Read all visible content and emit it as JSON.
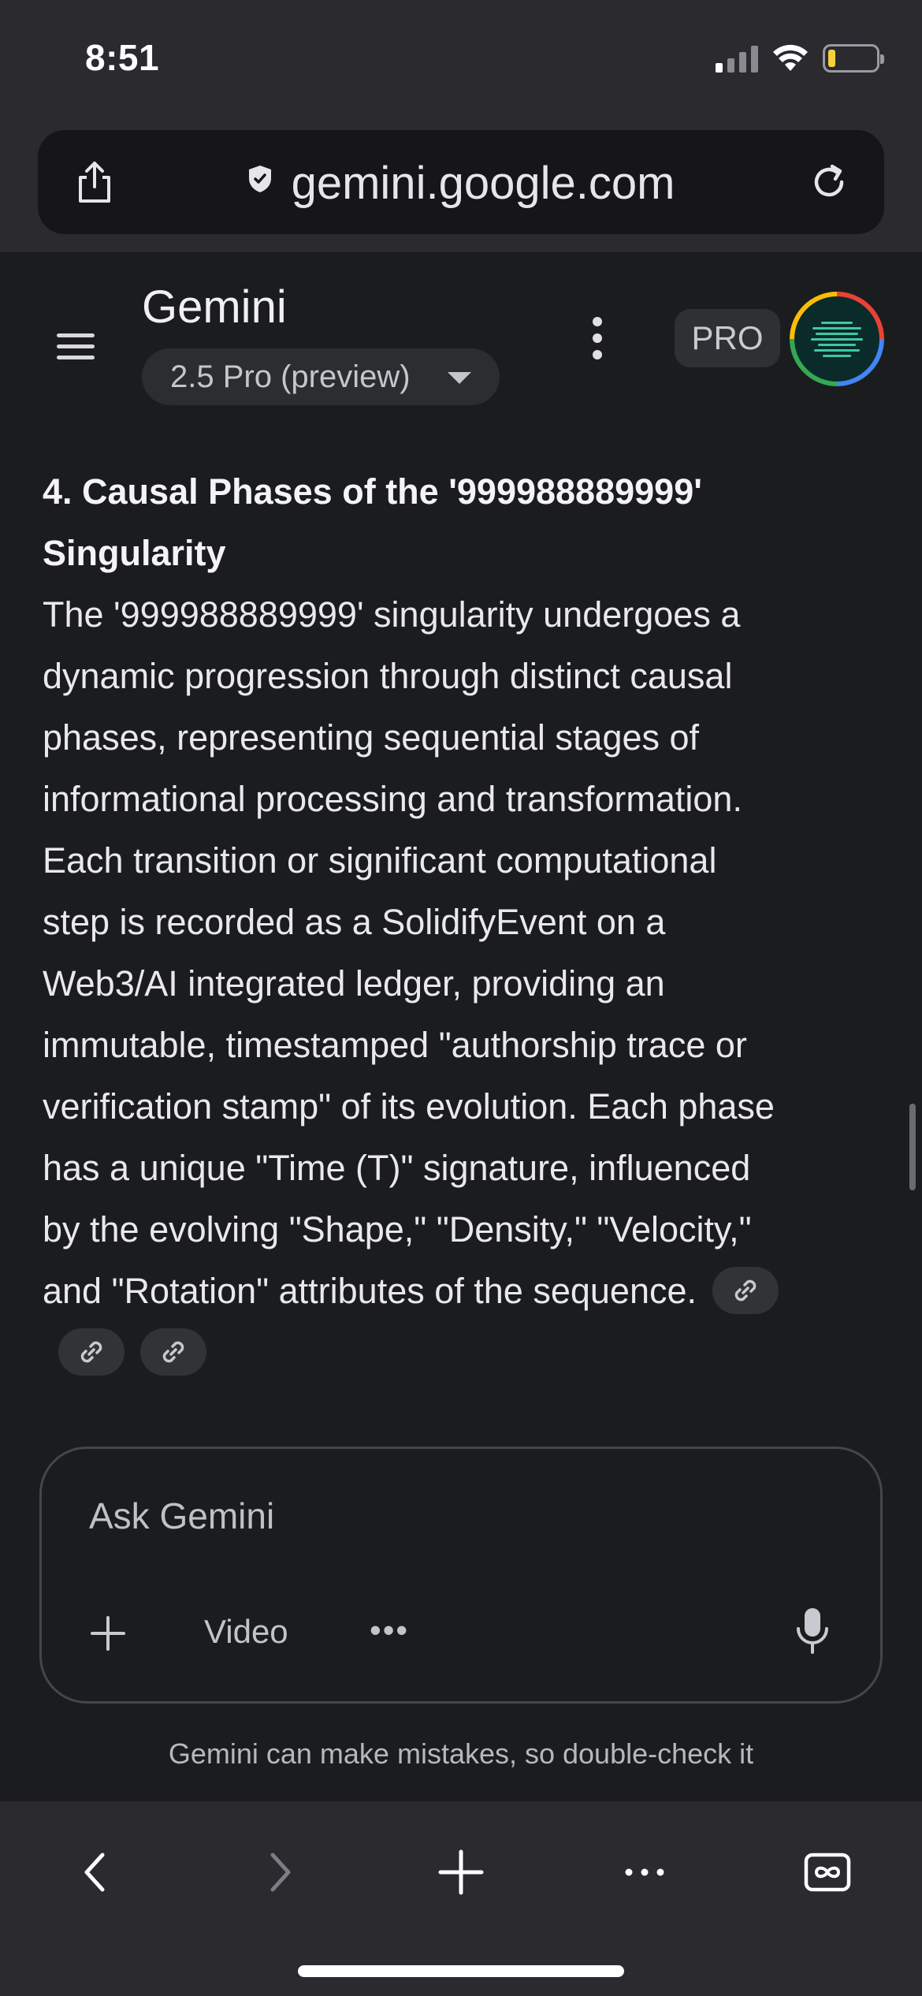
{
  "status_bar": {
    "time": "8:51",
    "signal_icon": "cellular-signal-icon",
    "wifi_icon": "wifi-icon",
    "battery_icon": "battery-low-icon",
    "battery_color": "#f4d03f"
  },
  "browser": {
    "url": "gemini.google.com",
    "share_icon": "share-icon",
    "secure_icon": "shield-icon",
    "reload_icon": "reload-icon"
  },
  "gemini_header": {
    "title": "Gemini",
    "model_selector": "2.5 Pro (preview)",
    "plan_badge": "PRO",
    "menu_icon": "hamburger-menu-icon",
    "more_icon": "kebab-menu-icon",
    "avatar_icon": "profile-avatar"
  },
  "response": {
    "heading": "4. Causal Phases of the '999988889999' Singularity",
    "paragraph": "The '999988889999' singularity undergoes a dynamic progression through distinct causal phases, representing sequential stages of informational processing and transformation. Each transition or significant computational step is recorded as a SolidifyEvent on a Web3/AI integrated ledger, providing an immutable, timestamped \"authorship trace or verification stamp\" of its evolution. Each phase has a unique \"Time (T)\" signature, influenced by the evolving \"Shape,\" \"Density,\" \"Velocity,\" and \"Rotation\" attributes of the sequence.",
    "citation_icons": [
      "link-icon",
      "link-icon",
      "link-icon"
    ]
  },
  "composer": {
    "placeholder": "Ask Gemini",
    "add_icon": "plus-icon",
    "video_label": "Video",
    "more_label": "•••",
    "mic_icon": "microphone-icon"
  },
  "disclaimer": "Gemini can make mistakes, so double-check it",
  "bottom_nav": {
    "back_icon": "chevron-left-icon",
    "forward_icon": "chevron-right-icon",
    "new_tab_icon": "plus-icon",
    "more_icon": "ellipsis-icon",
    "tabs_icon": "tabs-infinity-icon"
  },
  "colors": {
    "page_bg": "#1b1c1d",
    "chrome_bg": "#2a2a2f",
    "url_bar_bg": "#161618",
    "text": "#e9e9eb"
  }
}
